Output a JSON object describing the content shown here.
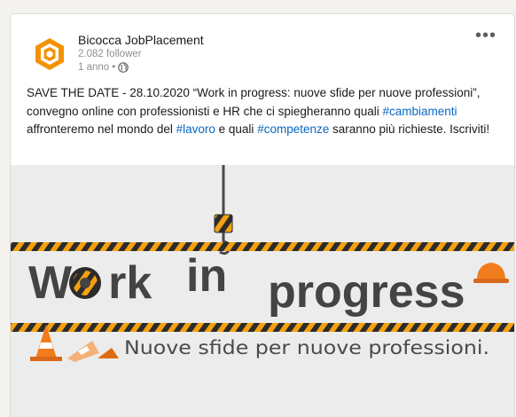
{
  "post": {
    "company_name": "Bicocca JobPlacement",
    "followers": "2.082 follower",
    "age": "1 anno",
    "age_separator": "•",
    "visibility_icon": "globe-icon",
    "more_label": "•••",
    "text": {
      "part1": "SAVE THE DATE - 28.10.2020 “Work in progress: nuove sfide per nuove professioni”, convegno online con professionisti e HR che ci spiegheranno quali ",
      "hashtag1": "#cambiamenti",
      "part2": " affronteremo nel mondo del ",
      "hashtag2": "#lavoro",
      "part3": " e quali ",
      "hashtag3": "#competenze",
      "part4": " saranno più richieste. Iscriviti!"
    }
  },
  "banner": {
    "title_part1": "W",
    "title_part2": "rk ",
    "title_part3": "in",
    "title_part4": "progress",
    "subtitle": "Nuove sfide per nuove professioni."
  },
  "colors": {
    "logo_orange": "#f39200",
    "hashtag_blue": "#0a66c2",
    "hazard_black": "#2b2b2b",
    "hazard_yellow": "#f5a00f",
    "title_gray": "#444444",
    "subtitle_gray": "#4a4a4a",
    "cone_orange": "#f07c1b"
  }
}
